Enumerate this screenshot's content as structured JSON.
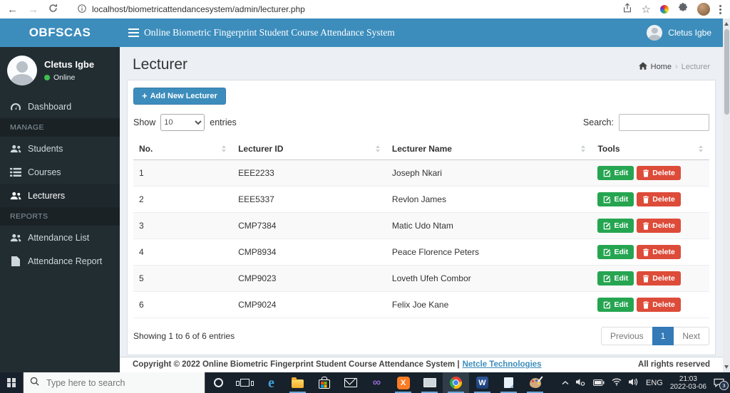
{
  "browser": {
    "url": "localhost/biometricattendancesystem/admin/lecturer.php"
  },
  "glyphs": {
    "back": "←",
    "forward": "→",
    "star": "☆",
    "plus": "+",
    "bc_sep": "›",
    "pipe": "|"
  },
  "header": {
    "brand": "OBFSCAS",
    "title": "Online Biometric Fingerprint Student Course Attendance System",
    "user_name": "Cletus Igbe"
  },
  "sidebar": {
    "user": {
      "name": "Cletus Igbe",
      "status": "Online"
    },
    "items": [
      {
        "type": "link",
        "icon": "dashboard-icon",
        "label": "Dashboard",
        "active": false
      },
      {
        "type": "section",
        "label": "MANAGE"
      },
      {
        "type": "link",
        "icon": "users-icon",
        "label": "Students",
        "active": false
      },
      {
        "type": "link",
        "icon": "list-icon",
        "label": "Courses",
        "active": false
      },
      {
        "type": "link",
        "icon": "users-icon",
        "label": "Lecturers",
        "active": true
      },
      {
        "type": "section",
        "label": "REPORTS"
      },
      {
        "type": "link",
        "icon": "users-icon",
        "label": "Attendance List",
        "active": false
      },
      {
        "type": "link",
        "icon": "file-icon",
        "label": "Attendance Report",
        "active": false
      }
    ]
  },
  "main": {
    "page_title": "Lecturer",
    "breadcrumb": {
      "home": "Home",
      "current": "Lecturer"
    },
    "add_button": "Add New Lecturer",
    "show_label": "Show",
    "entries_value": "10",
    "entries_label": "entries",
    "search_label": "Search:",
    "table": {
      "headers": [
        "No.",
        "Lecturer ID",
        "Lecturer Name",
        "Tools"
      ],
      "edit_label": "Edit",
      "delete_label": "Delete",
      "rows": [
        {
          "no": "1",
          "id": "EEE2233",
          "name": "Joseph Nkari"
        },
        {
          "no": "2",
          "id": "EEE5337",
          "name": "Revlon James"
        },
        {
          "no": "3",
          "id": "CMP7384",
          "name": "Matic Udo Ntam"
        },
        {
          "no": "4",
          "id": "CMP8934",
          "name": "Peace Florence Peters"
        },
        {
          "no": "5",
          "id": "CMP9023",
          "name": "Loveth Ufeh Combor"
        },
        {
          "no": "6",
          "id": "CMP9024",
          "name": "Felix Joe Kane"
        }
      ]
    },
    "info": "Showing 1 to 6 of 6 entries",
    "pagination": {
      "previous": "Previous",
      "current": "1",
      "next": "Next"
    }
  },
  "footer": {
    "copyright": "Copyright © 2022 Online Biometric Fingerprint Student Course Attendance System",
    "link": "Netcle Technologies",
    "rights": "All rights reserved"
  },
  "taskbar": {
    "search_placeholder": "Type here to search",
    "icons": [
      {
        "name": "cortana-icon",
        "open": false,
        "active": false
      },
      {
        "name": "taskview-icon",
        "open": false,
        "active": false
      },
      {
        "name": "edge-icon",
        "glyph": "e",
        "open": false,
        "active": false
      },
      {
        "name": "explorer-icon",
        "open": true,
        "active": false
      },
      {
        "name": "store-icon",
        "open": false,
        "active": false
      },
      {
        "name": "mail-icon",
        "open": false,
        "active": false
      },
      {
        "name": "visualstudio-icon",
        "glyph": "∞",
        "open": false,
        "active": false
      },
      {
        "name": "xampp-icon",
        "glyph": "X",
        "open": true,
        "active": false
      },
      {
        "name": "book-icon",
        "open": true,
        "active": false
      },
      {
        "name": "chrome-icon",
        "open": true,
        "active": true
      },
      {
        "name": "word-icon",
        "glyph": "W",
        "open": true,
        "active": false
      },
      {
        "name": "notepad-icon",
        "open": true,
        "active": false
      },
      {
        "name": "paint-icon",
        "open": true,
        "active": false
      }
    ],
    "tray": {
      "lang": "ENG",
      "time": "21:03",
      "date": "2022-03-06",
      "badge": "3"
    }
  },
  "colors": {
    "header_blue": "#3c8dbc",
    "sidebar_dark": "#222d32",
    "content_bg": "#ecf0f5",
    "edit_green": "#26a551",
    "delete_red": "#dd4b39",
    "pagination_active_blue": "#337ab7",
    "online_dot_green": "#3fbf4f",
    "taskbar_dark": "#17212b"
  }
}
